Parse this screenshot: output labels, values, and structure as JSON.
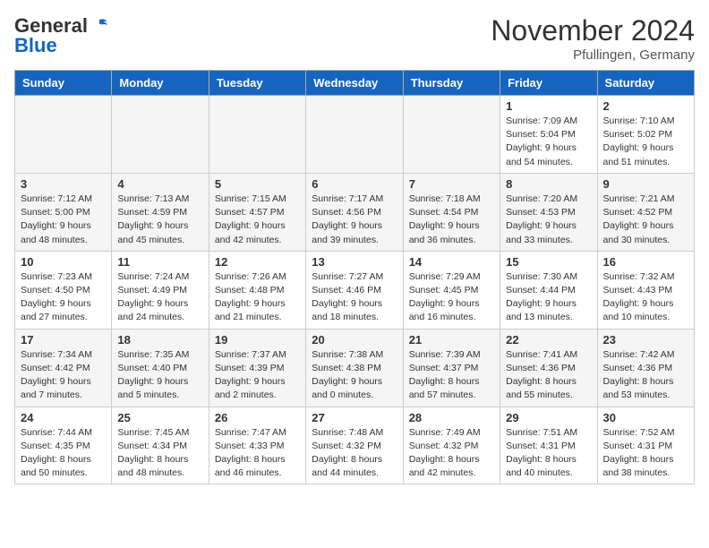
{
  "header": {
    "logo_line1": "General",
    "logo_line2": "Blue",
    "month_title": "November 2024",
    "location": "Pfullingen, Germany"
  },
  "weekdays": [
    "Sunday",
    "Monday",
    "Tuesday",
    "Wednesday",
    "Thursday",
    "Friday",
    "Saturday"
  ],
  "weeks": [
    [
      {
        "day": "",
        "info": ""
      },
      {
        "day": "",
        "info": ""
      },
      {
        "day": "",
        "info": ""
      },
      {
        "day": "",
        "info": ""
      },
      {
        "day": "",
        "info": ""
      },
      {
        "day": "1",
        "info": "Sunrise: 7:09 AM\nSunset: 5:04 PM\nDaylight: 9 hours\nand 54 minutes."
      },
      {
        "day": "2",
        "info": "Sunrise: 7:10 AM\nSunset: 5:02 PM\nDaylight: 9 hours\nand 51 minutes."
      }
    ],
    [
      {
        "day": "3",
        "info": "Sunrise: 7:12 AM\nSunset: 5:00 PM\nDaylight: 9 hours\nand 48 minutes."
      },
      {
        "day": "4",
        "info": "Sunrise: 7:13 AM\nSunset: 4:59 PM\nDaylight: 9 hours\nand 45 minutes."
      },
      {
        "day": "5",
        "info": "Sunrise: 7:15 AM\nSunset: 4:57 PM\nDaylight: 9 hours\nand 42 minutes."
      },
      {
        "day": "6",
        "info": "Sunrise: 7:17 AM\nSunset: 4:56 PM\nDaylight: 9 hours\nand 39 minutes."
      },
      {
        "day": "7",
        "info": "Sunrise: 7:18 AM\nSunset: 4:54 PM\nDaylight: 9 hours\nand 36 minutes."
      },
      {
        "day": "8",
        "info": "Sunrise: 7:20 AM\nSunset: 4:53 PM\nDaylight: 9 hours\nand 33 minutes."
      },
      {
        "day": "9",
        "info": "Sunrise: 7:21 AM\nSunset: 4:52 PM\nDaylight: 9 hours\nand 30 minutes."
      }
    ],
    [
      {
        "day": "10",
        "info": "Sunrise: 7:23 AM\nSunset: 4:50 PM\nDaylight: 9 hours\nand 27 minutes."
      },
      {
        "day": "11",
        "info": "Sunrise: 7:24 AM\nSunset: 4:49 PM\nDaylight: 9 hours\nand 24 minutes."
      },
      {
        "day": "12",
        "info": "Sunrise: 7:26 AM\nSunset: 4:48 PM\nDaylight: 9 hours\nand 21 minutes."
      },
      {
        "day": "13",
        "info": "Sunrise: 7:27 AM\nSunset: 4:46 PM\nDaylight: 9 hours\nand 18 minutes."
      },
      {
        "day": "14",
        "info": "Sunrise: 7:29 AM\nSunset: 4:45 PM\nDaylight: 9 hours\nand 16 minutes."
      },
      {
        "day": "15",
        "info": "Sunrise: 7:30 AM\nSunset: 4:44 PM\nDaylight: 9 hours\nand 13 minutes."
      },
      {
        "day": "16",
        "info": "Sunrise: 7:32 AM\nSunset: 4:43 PM\nDaylight: 9 hours\nand 10 minutes."
      }
    ],
    [
      {
        "day": "17",
        "info": "Sunrise: 7:34 AM\nSunset: 4:42 PM\nDaylight: 9 hours\nand 7 minutes."
      },
      {
        "day": "18",
        "info": "Sunrise: 7:35 AM\nSunset: 4:40 PM\nDaylight: 9 hours\nand 5 minutes."
      },
      {
        "day": "19",
        "info": "Sunrise: 7:37 AM\nSunset: 4:39 PM\nDaylight: 9 hours\nand 2 minutes."
      },
      {
        "day": "20",
        "info": "Sunrise: 7:38 AM\nSunset: 4:38 PM\nDaylight: 9 hours\nand 0 minutes."
      },
      {
        "day": "21",
        "info": "Sunrise: 7:39 AM\nSunset: 4:37 PM\nDaylight: 8 hours\nand 57 minutes."
      },
      {
        "day": "22",
        "info": "Sunrise: 7:41 AM\nSunset: 4:36 PM\nDaylight: 8 hours\nand 55 minutes."
      },
      {
        "day": "23",
        "info": "Sunrise: 7:42 AM\nSunset: 4:36 PM\nDaylight: 8 hours\nand 53 minutes."
      }
    ],
    [
      {
        "day": "24",
        "info": "Sunrise: 7:44 AM\nSunset: 4:35 PM\nDaylight: 8 hours\nand 50 minutes."
      },
      {
        "day": "25",
        "info": "Sunrise: 7:45 AM\nSunset: 4:34 PM\nDaylight: 8 hours\nand 48 minutes."
      },
      {
        "day": "26",
        "info": "Sunrise: 7:47 AM\nSunset: 4:33 PM\nDaylight: 8 hours\nand 46 minutes."
      },
      {
        "day": "27",
        "info": "Sunrise: 7:48 AM\nSunset: 4:32 PM\nDaylight: 8 hours\nand 44 minutes."
      },
      {
        "day": "28",
        "info": "Sunrise: 7:49 AM\nSunset: 4:32 PM\nDaylight: 8 hours\nand 42 minutes."
      },
      {
        "day": "29",
        "info": "Sunrise: 7:51 AM\nSunset: 4:31 PM\nDaylight: 8 hours\nand 40 minutes."
      },
      {
        "day": "30",
        "info": "Sunrise: 7:52 AM\nSunset: 4:31 PM\nDaylight: 8 hours\nand 38 minutes."
      }
    ]
  ]
}
